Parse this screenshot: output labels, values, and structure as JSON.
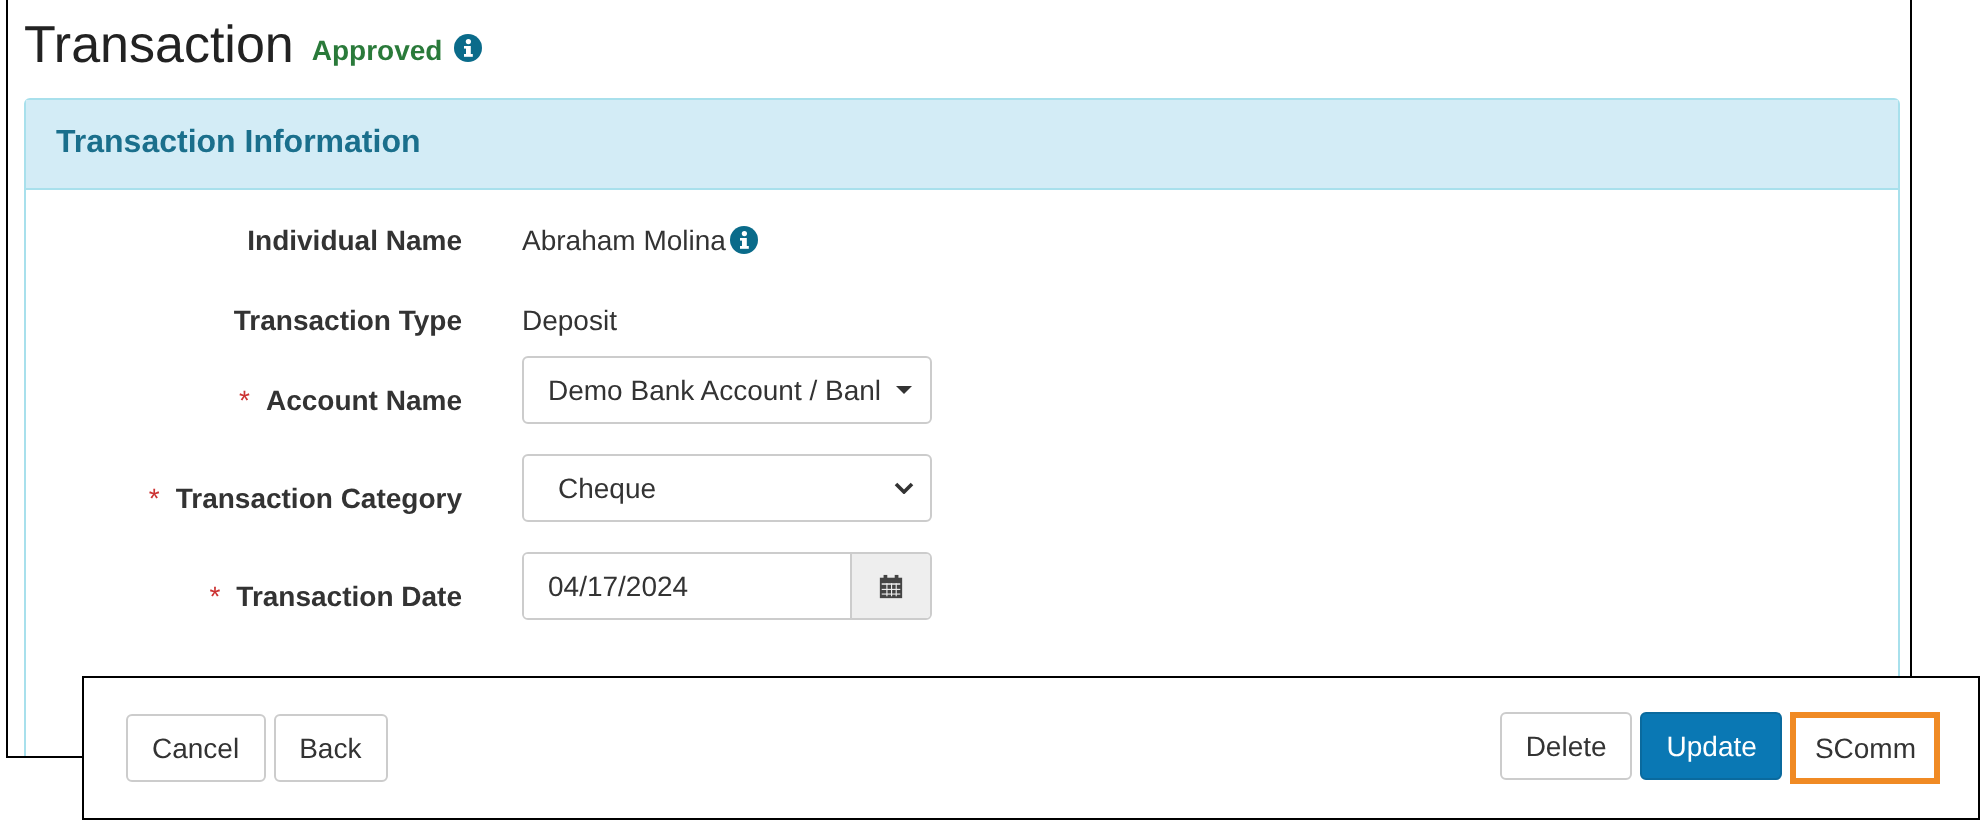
{
  "page": {
    "title": "Transaction",
    "status": "Approved"
  },
  "panel": {
    "title": "Transaction Information",
    "fields": [
      {
        "kind": "text",
        "label": "Individual Name",
        "value": "Abraham Molina",
        "info": true
      },
      {
        "kind": "text",
        "label": "Transaction Type",
        "value": "Deposit",
        "info": false
      },
      {
        "kind": "dropdown",
        "required_mark": "*",
        "label": "Account Name",
        "value": "Demo Bank Account / Banl"
      },
      {
        "kind": "select",
        "required_mark": "*",
        "label": "Transaction Category",
        "value": "Cheque"
      },
      {
        "kind": "date",
        "required_mark": "*",
        "label": "Transaction Date",
        "value": "04/17/2024"
      }
    ]
  },
  "footer": {
    "left_buttons": [
      {
        "label": "Cancel",
        "primary": false,
        "highlighted": false
      },
      {
        "label": "Back",
        "primary": false,
        "highlighted": false
      }
    ],
    "right_buttons": [
      {
        "label": "Delete",
        "primary": false,
        "highlighted": false
      },
      {
        "label": "Update",
        "primary": true,
        "highlighted": false
      },
      {
        "label": "SComm",
        "primary": false,
        "highlighted": true
      }
    ]
  }
}
